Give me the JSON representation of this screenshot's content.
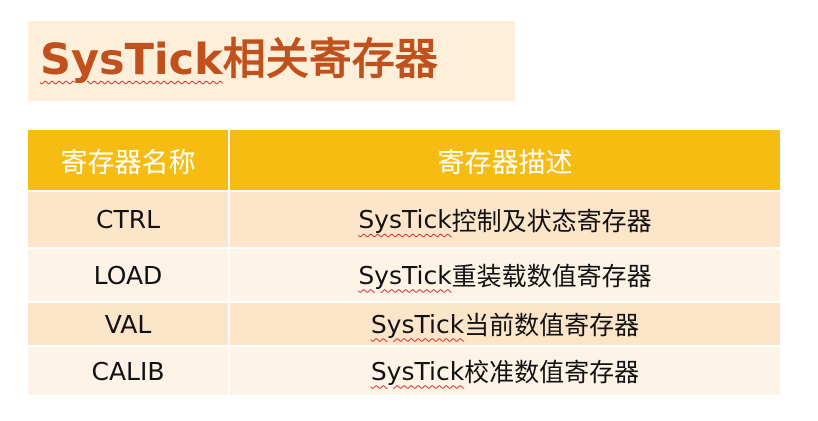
{
  "title": {
    "prefix": "SysTick",
    "suffix": "相关寄存器"
  },
  "table": {
    "headers": [
      "寄存器名称",
      "寄存器描述"
    ],
    "rows": [
      {
        "name": "CTRL",
        "desc_prefix": "SysTick",
        "desc_suffix": "控制及状态寄存器"
      },
      {
        "name": "LOAD",
        "desc_prefix": "SysTick",
        "desc_suffix": "重装载数值寄存器"
      },
      {
        "name": "VAL",
        "desc_prefix": "SysTick",
        "desc_suffix": "当前数值寄存器"
      },
      {
        "name": "CALIB",
        "desc_prefix": "SysTick",
        "desc_suffix": "校准数值寄存器"
      }
    ]
  },
  "colors": {
    "title_text": "#c0511c",
    "title_background": "#fdefd9",
    "header_background": "#f7bc12",
    "row_dark": "#fde5c9",
    "row_light": "#fef3e7"
  }
}
